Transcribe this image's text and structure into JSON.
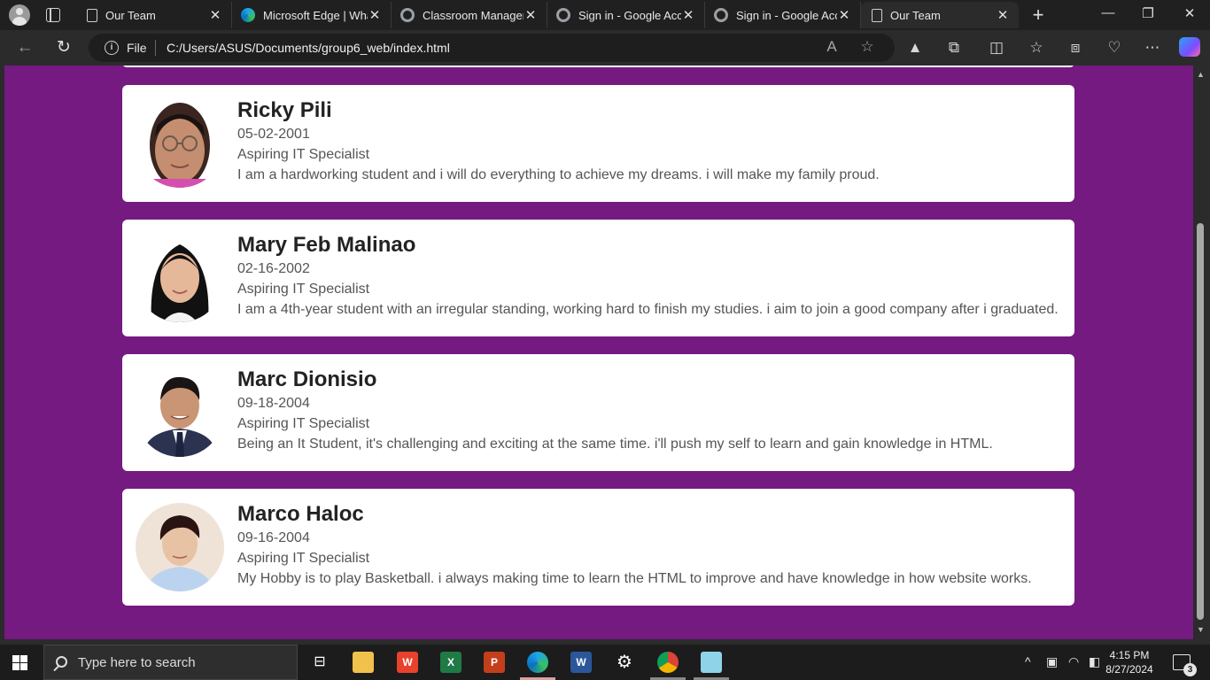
{
  "browser": {
    "tabs": [
      {
        "title": "Our Team",
        "icon": "document-icon",
        "active": false
      },
      {
        "title": "Microsoft Edge | What",
        "icon": "edge-icon",
        "active": false
      },
      {
        "title": "Classroom Manageme",
        "icon": "google-icon",
        "active": false
      },
      {
        "title": "Sign in - Google Acco",
        "icon": "google-icon",
        "active": false
      },
      {
        "title": "Sign in - Google Acco",
        "icon": "google-icon",
        "active": false
      },
      {
        "title": "Our Team",
        "icon": "document-icon",
        "active": true
      }
    ],
    "address": {
      "scheme_label": "File",
      "url": "C:/Users/ASUS/Documents/group6_web/index.html"
    }
  },
  "members": [
    {
      "name": "Ricky Pili",
      "birthdate": "05-02-2001",
      "role": "Aspiring IT Specialist",
      "bio": "I am a hardworking student and i will do everything to achieve my dreams. i will make my family proud."
    },
    {
      "name": "Mary Feb Malinao",
      "birthdate": "02-16-2002",
      "role": "Aspiring IT Specialist",
      "bio": "I am a 4th-year student with an irregular standing, working hard to finish my studies. i aim to join a good company after i graduated."
    },
    {
      "name": "Marc Dionisio",
      "birthdate": "09-18-2004",
      "role": "Aspiring IT Specialist",
      "bio": "Being an It Student, it's challenging and exciting at the same time. i'll push my self to learn and gain knowledge in HTML."
    },
    {
      "name": "Marco Haloc",
      "birthdate": "09-16-2004",
      "role": "Aspiring IT Specialist",
      "bio": "My Hobby is to play Basketball. i always making time to learn the HTML to improve and have knowledge in how website works."
    }
  ],
  "colors": {
    "page_background": "#741a81",
    "card_background": "#ffffff"
  },
  "taskbar": {
    "search_placeholder": "Type here to search",
    "time": "4:15 PM",
    "date": "8/27/2024",
    "notification_count": "3"
  }
}
